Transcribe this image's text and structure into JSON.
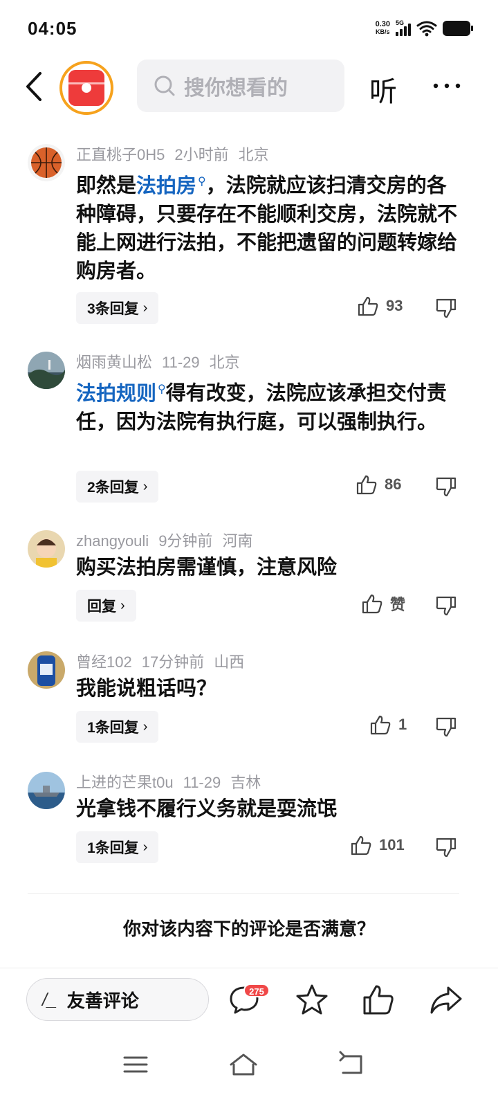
{
  "status_bar": {
    "time": "04:05",
    "net_speed": "0.30",
    "net_unit": "KB/s",
    "network": "5G"
  },
  "header": {
    "back_icon": "chevron-left-icon",
    "search_placeholder": "搜你想看的",
    "listen_label": "听",
    "more_icon": "more-horizontal-icon"
  },
  "colors": {
    "link_blue": "#1565c0",
    "badge_red": "#f04848",
    "logo_orange": "#f6a21d",
    "logo_red": "#ee3b3b"
  },
  "comments": [
    {
      "user": "正直桃子0H5",
      "time": "2小时前",
      "location": "北京",
      "avatar_icon": "basketball-avatar",
      "text_link": "法拍房",
      "text_before": "即然是",
      "text_after": "，法院就应该扫清交房的各种障碍，只要存在不能顺利交房，法院就不能上网进行法拍，不能把遗留的问题转嫁给购房者。",
      "reply_label": "3条回复",
      "likes": "93"
    },
    {
      "user": "烟雨黄山松",
      "time": "11-29",
      "location": "北京",
      "avatar_icon": "landscape-avatar",
      "text_link": "法拍规则",
      "text_before": "",
      "text_after": "得有改变，法院应该承担交付责任，因为法院有执行庭，可以强制执行。",
      "reply_label": "2条回复",
      "likes": "86"
    },
    {
      "user": "zhangyouli",
      "time": "9分钟前",
      "location": "河南",
      "avatar_icon": "child-avatar",
      "text_link": "",
      "text_before": "购买法拍房需谨慎，注意风险",
      "text_after": "",
      "reply_label": "回复",
      "likes": "赞"
    },
    {
      "user": "曾经102",
      "time": "17分钟前",
      "location": "山西",
      "avatar_icon": "bottle-avatar",
      "text_link": "",
      "text_before": "我能说粗话吗？",
      "text_after": "",
      "reply_label": "1条回复",
      "likes": "1"
    },
    {
      "user": "上进的芒果t0u",
      "time": "11-29",
      "location": "吉林",
      "avatar_icon": "ship-avatar",
      "text_link": "",
      "text_before": "光拿钱不履行义务就是耍流氓",
      "text_after": "",
      "reply_label": "1条回复",
      "likes": "101"
    }
  ],
  "survey": {
    "question": "你对该内容下的评论是否满意？"
  },
  "action_bar": {
    "comment_placeholder": "友善评论",
    "comment_count": "275"
  }
}
